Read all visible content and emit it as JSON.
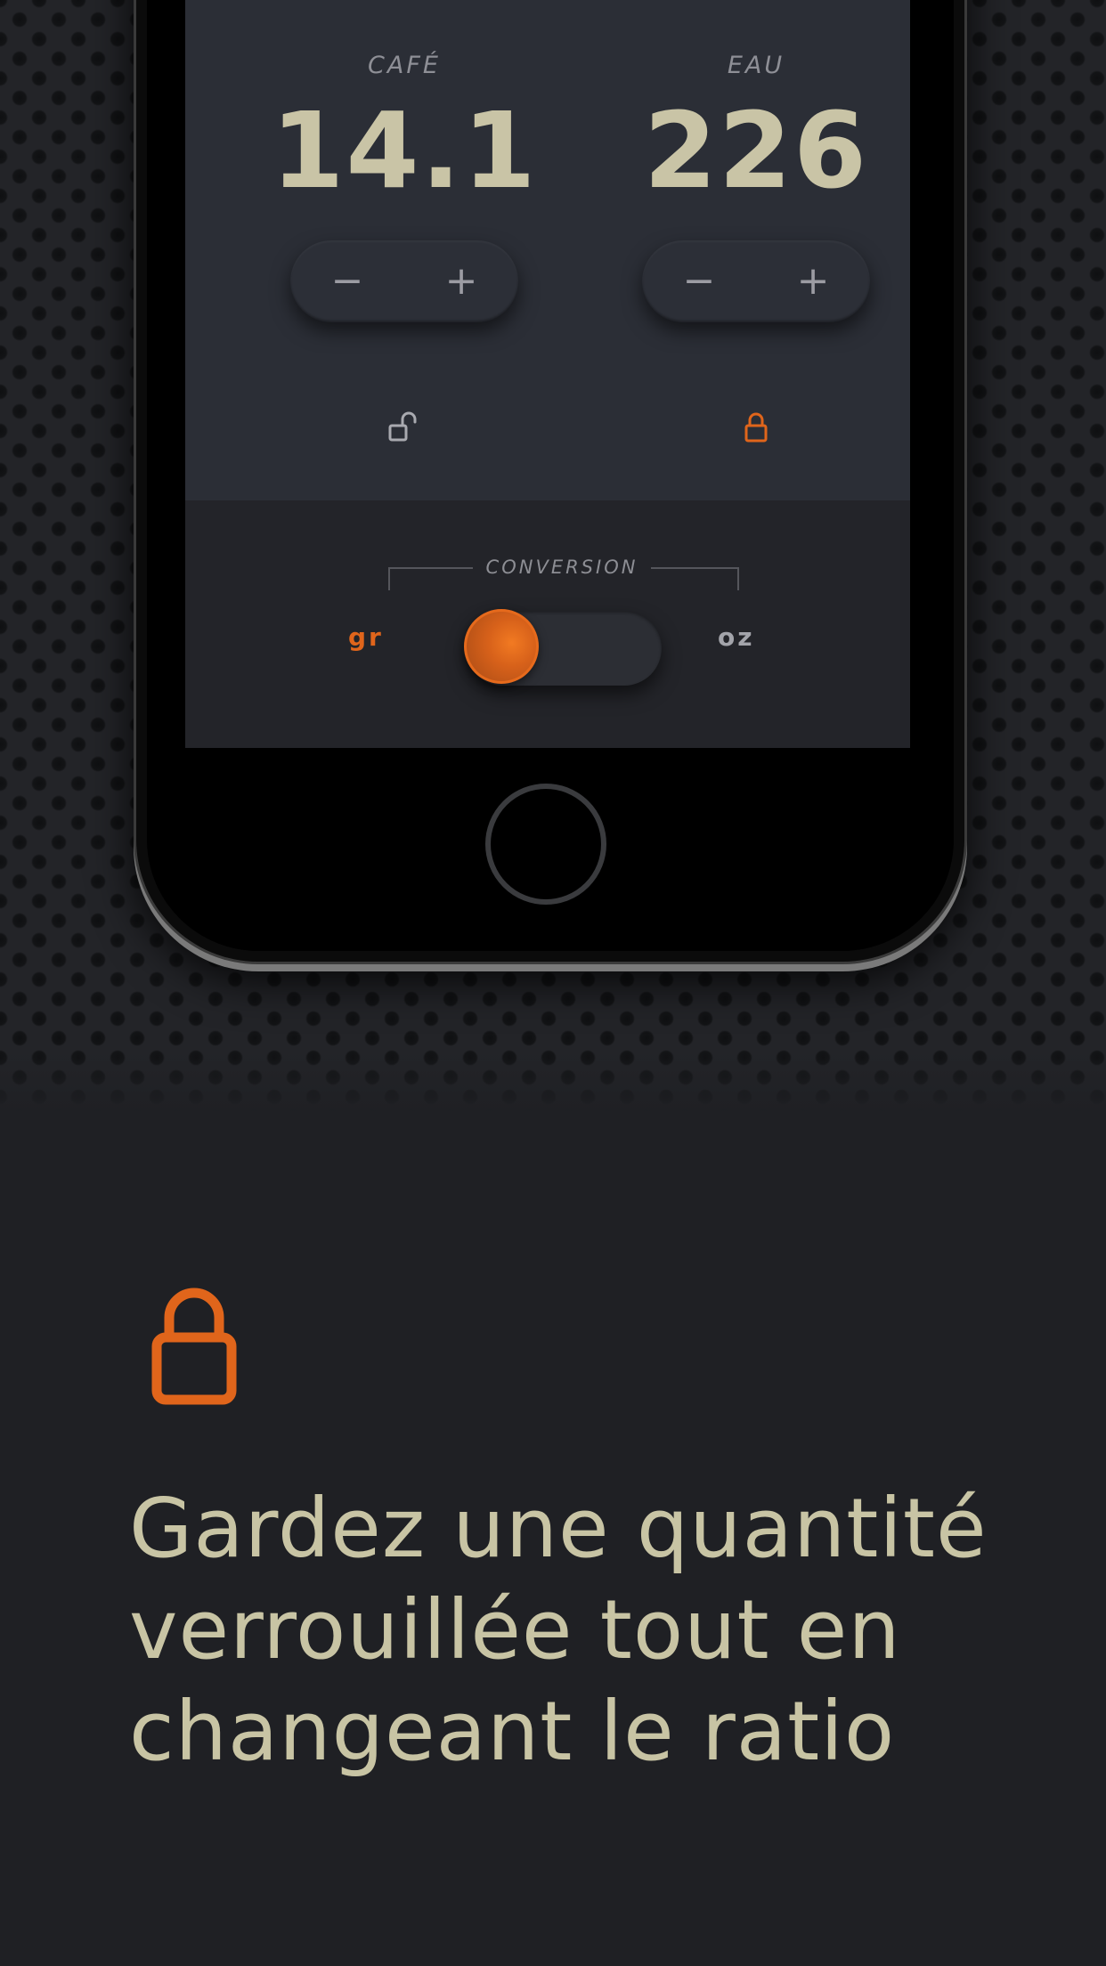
{
  "calculator": {
    "coffee": {
      "label": "CAFÉ",
      "value": "14.1",
      "decrement_label": "−",
      "increment_label": "+",
      "lock_state": "unlocked",
      "lock_icon": "lock-open-icon"
    },
    "water": {
      "label": "EAU",
      "value": "226",
      "decrement_label": "−",
      "increment_label": "+",
      "lock_state": "locked",
      "lock_icon": "lock-closed-icon"
    },
    "conversion": {
      "label": "CONVERSION",
      "left_unit": "gr",
      "right_unit": "oz",
      "selected": "gr"
    }
  },
  "feature": {
    "icon": "lock-closed-icon",
    "lines": [
      "Gardez une quantité",
      "verrouillée tout en",
      "changeant le ratio"
    ]
  },
  "colors": {
    "accent": "#e0651b",
    "number": "#c9c4a6",
    "background": "#1f2024",
    "screen": "#2b2e36"
  }
}
